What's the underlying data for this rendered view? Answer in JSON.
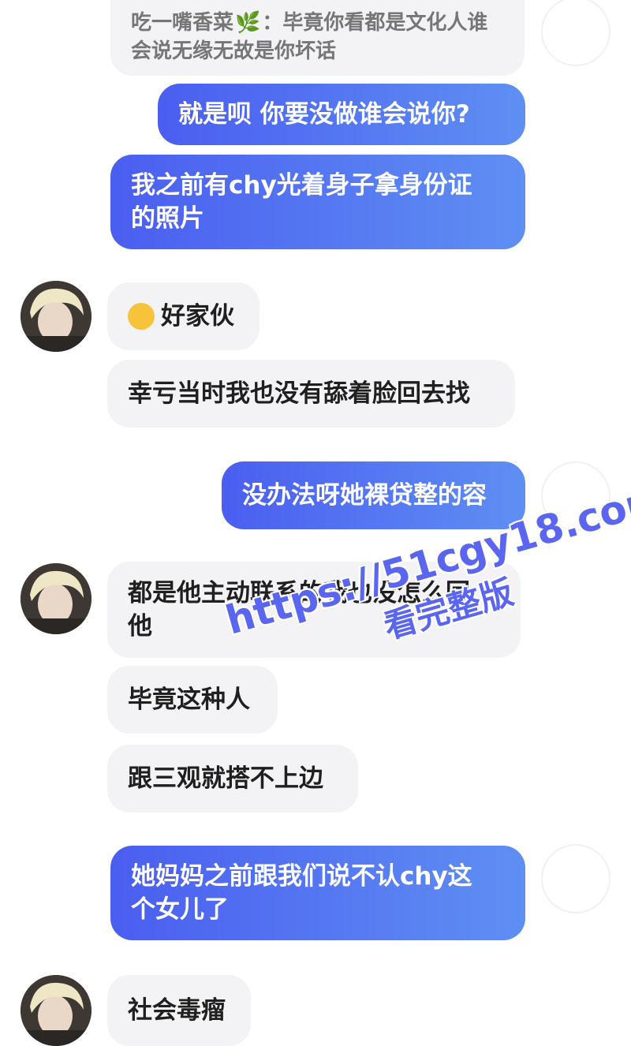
{
  "messages": [
    {
      "side": "in",
      "quote_name": "吃一嘴香菜",
      "quote_text_1": "：毕竟你看都是文化人谁",
      "quote_text_2": "会说无缘无故是你坏话"
    },
    {
      "side": "out",
      "text": "就是呗 你要没做谁会说你?"
    },
    {
      "side": "out",
      "line1": "我之前有chy光着身子拿身份证",
      "line2": "的照片"
    },
    {
      "side": "in",
      "text": "好家伙"
    },
    {
      "side": "in",
      "text": "幸亏当时我也没有舔着脸回去找"
    },
    {
      "side": "out",
      "text": "没办法呀她裸贷整的容"
    },
    {
      "side": "in",
      "line1": "都是他主动联系的我也没怎么回",
      "line2": "他"
    },
    {
      "side": "in",
      "text": "毕竟这种人"
    },
    {
      "side": "in",
      "text": "跟三观就搭不上边"
    },
    {
      "side": "out",
      "line1": "她妈妈之前跟我们说不认chy这",
      "line2": "个女儿了"
    },
    {
      "side": "in",
      "text": "社会毒瘤"
    }
  ],
  "watermark": {
    "url": "https://51cgy18.com",
    "sub": "看完整版"
  },
  "icons": {
    "quote_leaf": "leaf-icon",
    "emoji": "crying-laughing-emoji"
  },
  "colors": {
    "out_start": "#4a5ef0",
    "out_end": "#5f8ff3",
    "in_bg": "#f3f3f5",
    "watermark": "#5a66f0"
  }
}
